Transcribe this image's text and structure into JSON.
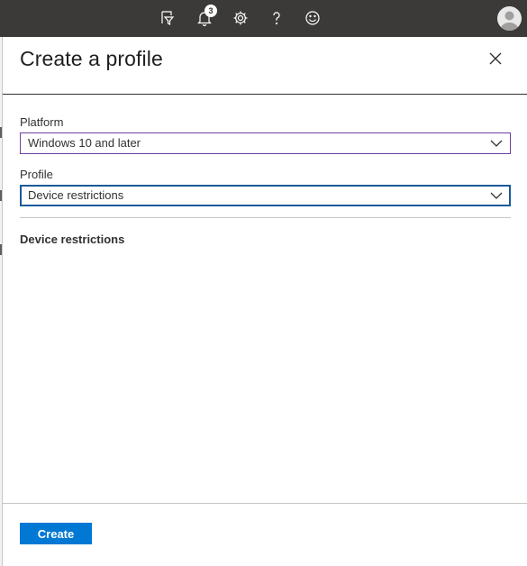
{
  "topbar": {
    "notification_count": "3",
    "icons": [
      "feedback-filter-icon",
      "bell-icon",
      "gear-icon",
      "help-icon",
      "smiley-icon",
      "avatar"
    ]
  },
  "panel": {
    "title": "Create a profile",
    "platform": {
      "label": "Platform",
      "value": "Windows 10 and later"
    },
    "profile": {
      "label": "Profile",
      "value": "Device restrictions"
    },
    "section_title": "Device restrictions",
    "create_label": "Create"
  },
  "colors": {
    "topbar_bg": "#3b3a39",
    "accent": "#0078d4",
    "platform_border": "#6b3fa0",
    "profile_border": "#1a5a9a"
  }
}
